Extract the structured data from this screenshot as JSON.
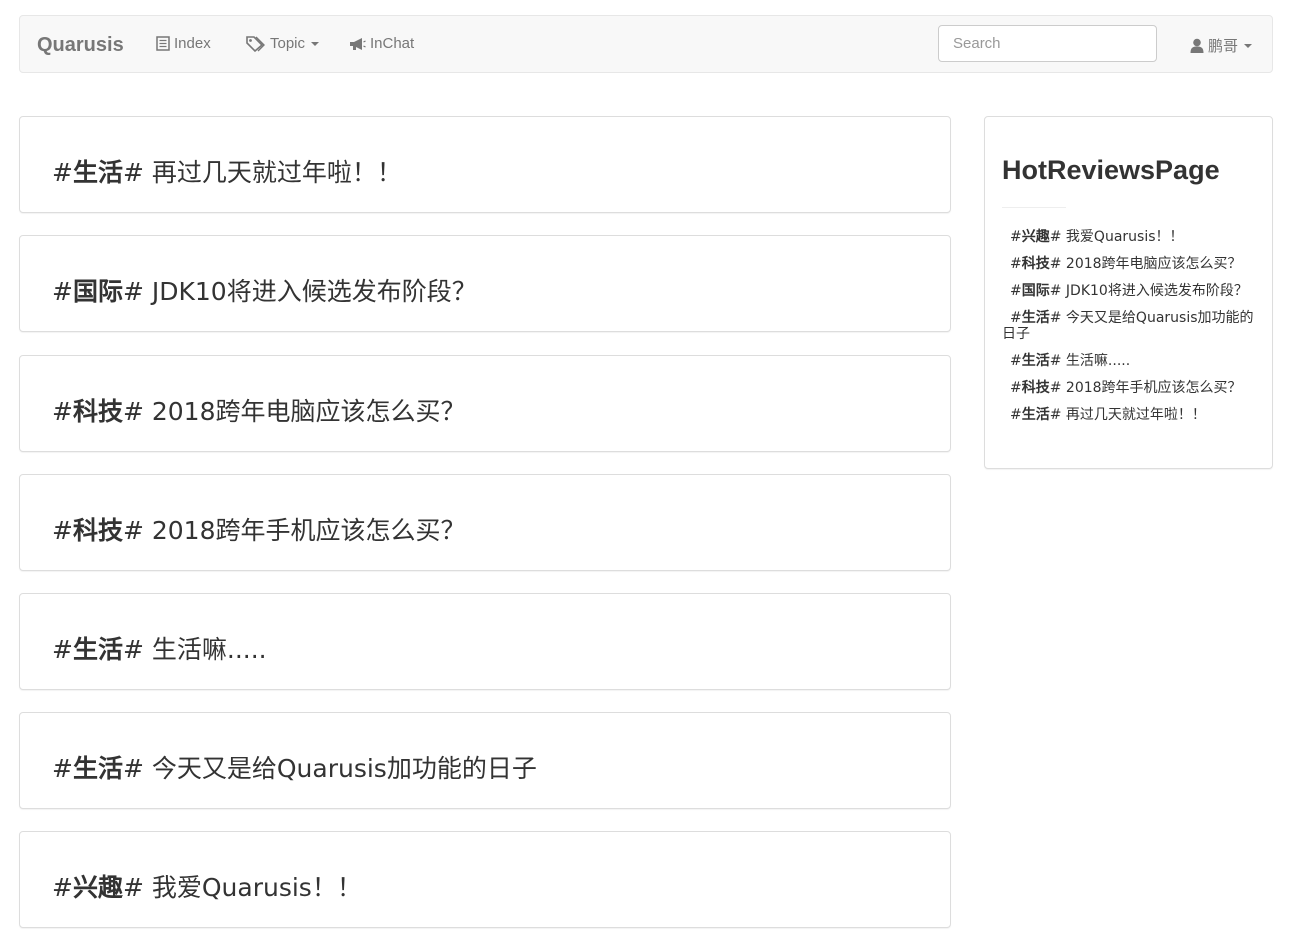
{
  "navbar": {
    "brand": "Quarusis",
    "links": [
      {
        "label": "Index",
        "icon": "list-icon"
      },
      {
        "label": "Topic",
        "icon": "tags-icon",
        "dropdown": true
      },
      {
        "label": "InChat",
        "icon": "bullhorn-icon"
      }
    ],
    "search": {
      "placeholder": "Search",
      "value": ""
    },
    "user": {
      "label": "鹏哥",
      "icon": "user-icon",
      "dropdown": true
    }
  },
  "posts": [
    {
      "tag": "生活",
      "title": "再过几天就过年啦！！"
    },
    {
      "tag": "国际",
      "title": "JDK10将进入候选发布阶段？"
    },
    {
      "tag": "科技",
      "title": "2018跨年电脑应该怎么买？"
    },
    {
      "tag": "科技",
      "title": "2018跨年手机应该怎么买？"
    },
    {
      "tag": "生活",
      "title": "生活嘛....."
    },
    {
      "tag": "生活",
      "title": "今天又是给Quarusis加功能的日子"
    },
    {
      "tag": "兴趣",
      "title": "我爱Quarusis！！"
    }
  ],
  "sidebar": {
    "title": "HotReviewsPage",
    "items": [
      {
        "tag": "兴趣",
        "title": "我爱Quarusis！！"
      },
      {
        "tag": "科技",
        "title": "2018跨年电脑应该怎么买？"
      },
      {
        "tag": "国际",
        "title": "JDK10将进入候选发布阶段？"
      },
      {
        "tag": "生活",
        "title": "今天又是给Quarusis加功能的日子"
      },
      {
        "tag": "生活",
        "title": "生活嘛....."
      },
      {
        "tag": "科技",
        "title": "2018跨年手机应该怎么买？"
      },
      {
        "tag": "生活",
        "title": "再过几天就过年啦！！"
      }
    ]
  }
}
